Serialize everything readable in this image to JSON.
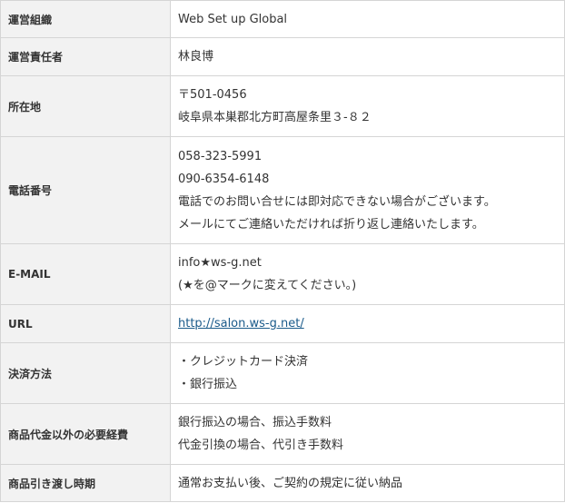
{
  "rows": [
    {
      "label": "運営組織",
      "lines": [
        "Web Set up Global"
      ]
    },
    {
      "label": "運営責任者",
      "lines": [
        "林良博"
      ]
    },
    {
      "label": "所在地",
      "lines": [
        "〒501-0456",
        "岐阜県本巣郡北方町高屋条里３-８２"
      ]
    },
    {
      "label": "電話番号",
      "lines": [
        "058-323-5991",
        "090-6354-6148",
        "電話でのお問い合せには即対応できない場合がございます。",
        "メールにてご連絡いただければ折り返し連絡いたします。"
      ]
    },
    {
      "label": "E-MAIL",
      "lines": [
        "info★ws-g.net",
        "(★を@マークに変えてください。)"
      ]
    },
    {
      "label": "URL",
      "link": "http://salon.ws-g.net/"
    },
    {
      "label": "決済方法",
      "lines": [
        "・クレジットカード決済",
        "・銀行振込"
      ]
    },
    {
      "label": "商品代金以外の必要経費",
      "lines": [
        "銀行振込の場合、振込手数料",
        "代金引換の場合、代引き手数料"
      ]
    },
    {
      "label": "商品引き渡し時期",
      "lines": [
        "通常お支払い後、ご契約の規定に従い納品"
      ]
    }
  ]
}
